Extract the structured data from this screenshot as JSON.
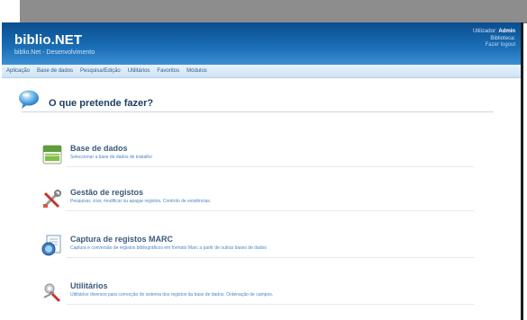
{
  "app": {
    "name": "biblio.NET",
    "subtitle": "biblio.Net - Desenvolvimento"
  },
  "user": {
    "utilizador_label": "Utilizador:",
    "utilizador_value": "Admin",
    "biblioteca_label": "Biblioteca:",
    "biblioteca_value": "",
    "logout_label": "Fazer logout"
  },
  "menu": [
    "Aplicação",
    "Base de dados",
    "Pesquisa/Edição",
    "Utilitários",
    "Favoritos",
    "Módulos"
  ],
  "page": {
    "question": "O que pretende fazer?"
  },
  "items": [
    {
      "title": "Base de dados",
      "desc": "Seleccionar a base de dados de trabalho",
      "icon": "database-icon"
    },
    {
      "title": "Gestão de registos",
      "desc": "Pesquisar, criar, modificar ou apagar registos. Controlo de existências.",
      "icon": "tools-icon"
    },
    {
      "title": "Captura de registos MARC",
      "desc": "Captura e conversão de registos bibliográficos em formato Marc a partir de outras bases de dados",
      "icon": "capture-icon"
    },
    {
      "title": "Utilitários",
      "desc": "Utilitários diversos para correcção do sistema dos registos da base de dados. Ordenação de campos.",
      "icon": "utilities-icon"
    }
  ],
  "colors": {
    "header": "#1b6fb7",
    "menubar": "#dbeaf8",
    "title": "#1d3f63",
    "link": "#4a86c7"
  }
}
